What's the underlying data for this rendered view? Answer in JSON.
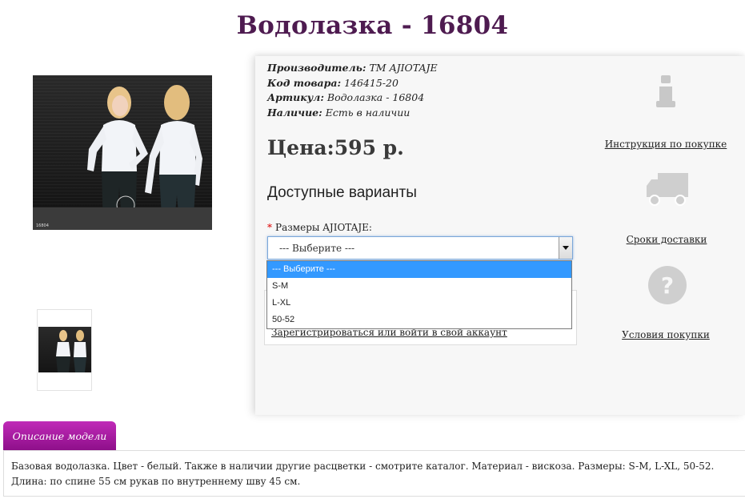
{
  "product": {
    "title": "Водолазка - 16804",
    "photo_code": "16804",
    "photo_logo": "Ajotaje"
  },
  "meta": {
    "manufacturer_label": "Производитель:",
    "manufacturer_value": "ТМ AJIOTAJE",
    "code_label": "Код товара:",
    "code_value": "146415-20",
    "article_label": "Артикул:",
    "article_value": "Водолазка - 16804",
    "stock_label": "Наличие:",
    "stock_value": "Есть в наличии"
  },
  "price": "Цена:595 р.",
  "variants": {
    "title": "Доступные варианты",
    "required_mark": "*",
    "size_label": "Размеры AJIOTAJE:",
    "selected": "--- Выберите ---",
    "options": [
      "--- Выберите ---",
      "S-M",
      "L-XL",
      "50-52"
    ]
  },
  "login_link": "Зарегистрироваться или войти в свой аккаунт",
  "sidebar": {
    "instruction": "Инструкция по покупке",
    "delivery": "Сроки доставки",
    "terms": "Условия покупки"
  },
  "tabs": {
    "description": "Описание модели"
  },
  "description": "Базовая водолазка. Цвет - белый. Также в наличии другие расцветки - смотрите каталог. Материал - вискоза. Размеры: S-M, L-XL, 50-52. Длина: по спине 55 см рукав по внутреннему шву 45 см.",
  "colors": {
    "title": "#4e1b50",
    "tab": "#a71ea1",
    "selected_option": "#3399ff",
    "icon_gray": "#cccccc"
  }
}
